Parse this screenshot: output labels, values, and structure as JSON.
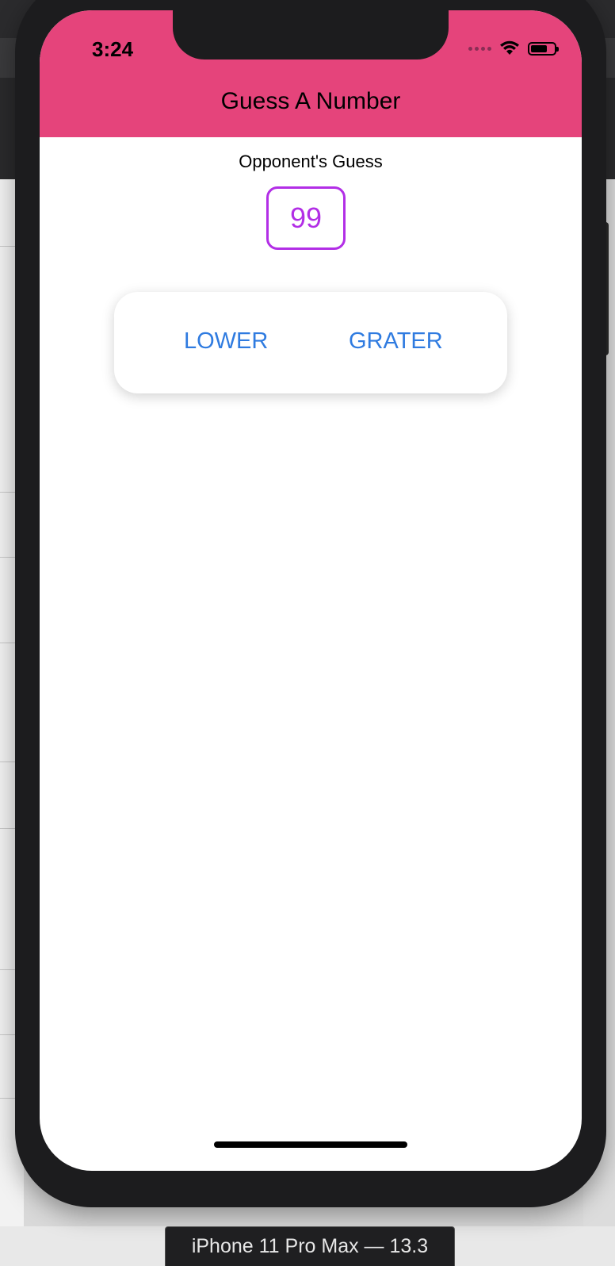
{
  "status_bar": {
    "time": "3:24",
    "icons": [
      "signal-icon",
      "wifi-icon",
      "battery-icon"
    ]
  },
  "header": {
    "title": "Guess A Number",
    "background_color": "#e5447b"
  },
  "game": {
    "label": "Opponent's Guess",
    "guess": "99",
    "accent_color": "#b22ee6"
  },
  "controls": {
    "lower_label": "LOWER",
    "greater_label": "GRATER",
    "button_color": "#2f7be0"
  },
  "simulator": {
    "device_label": "iPhone 11 Pro Max — 13.3"
  }
}
